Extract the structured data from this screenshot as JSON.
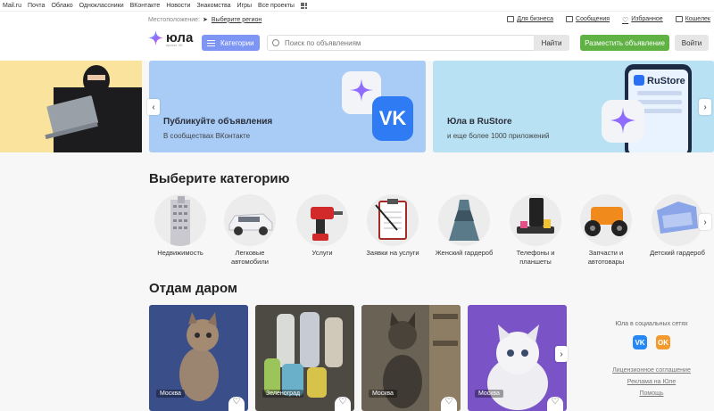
{
  "topbar": {
    "links": [
      "Mail.ru",
      "Почта",
      "Облако",
      "Одноклассники",
      "ВКонтакте",
      "Новости",
      "Знакомства",
      "Игры",
      "Все проекты"
    ]
  },
  "header": {
    "location_label": "Местоположение:",
    "region_link": "Выберите регион",
    "links": {
      "business": "Для бизнеса",
      "messages": "Сообщения",
      "favorites": "Избранное",
      "wallet": "Кошелек"
    },
    "logo_text": "юла",
    "logo_sub": "проект VK",
    "categories_button": "Категории",
    "search_placeholder": "Поиск по объявлениям",
    "find_button": "Найти",
    "post_button": "Разместить объявление",
    "login_button": "Войти"
  },
  "banners": [
    {
      "title": "Публикуйте объявления",
      "subtitle": "В сообществах ВКонтакте"
    },
    {
      "title": "Юла в RuStore",
      "subtitle": "и еще более 1000 приложений",
      "store_label": "RuStore"
    }
  ],
  "categories": {
    "title": "Выберите категорию",
    "items": [
      {
        "label": "Недвижимость"
      },
      {
        "label": "Легковые автомобили"
      },
      {
        "label": "Услуги"
      },
      {
        "label": "Заявки на услуги"
      },
      {
        "label": "Женский гардероб"
      },
      {
        "label": "Телефоны и планшеты"
      },
      {
        "label": "Запчасти и автотовары"
      },
      {
        "label": "Детский гардероб"
      }
    ]
  },
  "free": {
    "title": "Отдам даром",
    "cards": [
      {
        "city": "Москва"
      },
      {
        "city": "Зеленоград"
      },
      {
        "city": "Москва"
      },
      {
        "city": "Москва"
      }
    ]
  },
  "sidebar": {
    "social_title": "Юла в социальных сетях",
    "vk": "VK",
    "ok": "OK",
    "links": [
      "Лицензионное соглашение",
      "Реклама на Юле",
      "Помощь"
    ]
  }
}
